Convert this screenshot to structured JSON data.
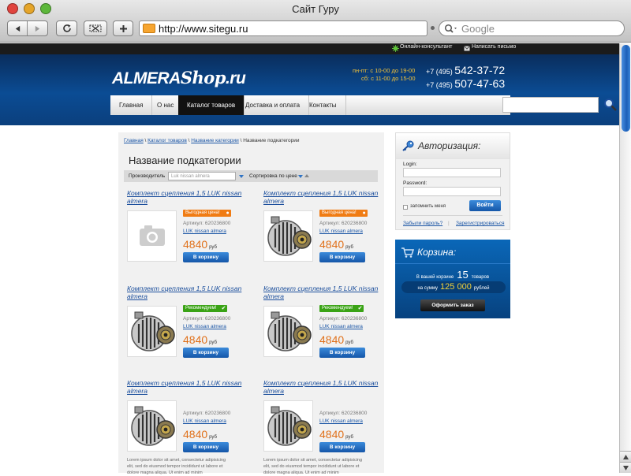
{
  "browser": {
    "title": "Сайт Гуру",
    "url": "http://www.sitegu.ru",
    "search_placeholder": "Google"
  },
  "topbar": {
    "consultant": "Онлайн-консультант",
    "write_letter": "Написать письмо"
  },
  "header": {
    "logo_main": "ALMERA",
    "logo_script": "Shop",
    "logo_tld": ".ru",
    "hours_weekdays": "пн-пт: с 10-00 до 19-00",
    "hours_saturday": "сб: с 11-00 до 15-00",
    "phone1_code": "+7 (495)",
    "phone1_number": "542-37-72",
    "phone2_code": "+7 (495)",
    "phone2_number": "507-47-63"
  },
  "nav": {
    "items": [
      {
        "label": "Главная"
      },
      {
        "label": "О нас"
      },
      {
        "label": "Каталог товаров"
      },
      {
        "label": "Доставка и оплата"
      },
      {
        "label": "Контакты"
      }
    ]
  },
  "breadcrumbs": {
    "home": "Главная",
    "catalog": "Каталог товаров",
    "category": "Название категории",
    "current": "Название подкатегории",
    "sep": " \\ "
  },
  "page": {
    "title": "Название подкатегории"
  },
  "filters": {
    "manufacturer_label": "Производитель",
    "manufacturer_placeholder": "Luk nissan almera",
    "sort_label": "Сортировка по цене"
  },
  "products": [
    {
      "title": "Комплект сцепления 1,5 LUK nissan almera",
      "badge": "Выгодная цена!",
      "badge_type": "orange",
      "sku": "Артикул: 620236800",
      "brand": "LUK nissan almera",
      "price": "4840",
      "currency": "руб",
      "button": "В корзину",
      "image": "camera-placeholder"
    },
    {
      "title": "Комплект сцепления 1,5 LUK nissan almera",
      "badge": "Выгодная цена!",
      "badge_type": "orange",
      "sku": "Артикул: 620236800",
      "brand": "LUK nissan almera",
      "price": "4840",
      "currency": "руб",
      "button": "В корзину",
      "image": "alternator"
    },
    {
      "title": "Комплект сцепления 1,5 LUK nissan almera",
      "badge": "Рекомендуем!",
      "badge_type": "green",
      "sku": "Артикул: 620236800",
      "brand": "LUK nissan almera",
      "price": "4840",
      "currency": "руб",
      "button": "В корзину",
      "image": "alternator"
    },
    {
      "title": "Комплект сцепления 1,5 LUK nissan almera",
      "badge": "Рекомендуем!",
      "badge_type": "green",
      "sku": "Артикул: 620236800",
      "brand": "LUK nissan almera",
      "price": "4840",
      "currency": "руб",
      "button": "В корзину",
      "image": "alternator"
    },
    {
      "title": "Комплект сцепления 1,5 LUK nissan almera",
      "badge": "",
      "badge_type": "",
      "sku": "Артикул: 620236800",
      "brand": "LUK nissan almera",
      "price": "4840",
      "currency": "руб",
      "button": "В корзину",
      "image": "alternator",
      "desc": "Lorem ipsum dolor sit amet, consectetur adipisicing elit, sed do eiusmod tempor incididunt ut labore et dolore magna aliqua. Ut enim ad minim"
    },
    {
      "title": "Комплект сцепления 1,5 LUK nissan almera",
      "badge": "",
      "badge_type": "",
      "sku": "Артикул: 620236800",
      "brand": "LUK nissan almera",
      "price": "4840",
      "currency": "руб",
      "button": "В корзину",
      "image": "alternator",
      "desc": "Lorem ipsum dolor sit amet, consectetur adipisicing elit, sed do eiusmod tempor incididunt ut labore et dolore magna aliqua. Ut enim ad minim"
    }
  ],
  "auth": {
    "title": "Авторизация:",
    "login_label": "Login:",
    "password_label": "Password:",
    "remember": "запомнить меня",
    "submit": "Войти",
    "forgot": "Забыли пароль?",
    "separator": "|",
    "register": "Зарегистрироваться"
  },
  "cart": {
    "title": "Корзина:",
    "in_cart_prefix": "В вашей корзине",
    "count": "15",
    "count_suffix": "товаров",
    "sum_prefix": "на сумму",
    "sum": "125 000",
    "sum_suffix": "рублей",
    "checkout": "Оформить заказ"
  },
  "colors": {
    "brand_blue": "#0b4c94",
    "accent_orange": "#e0711b",
    "badge_green": "#3aa315",
    "price_yellow": "#f2d23a"
  }
}
